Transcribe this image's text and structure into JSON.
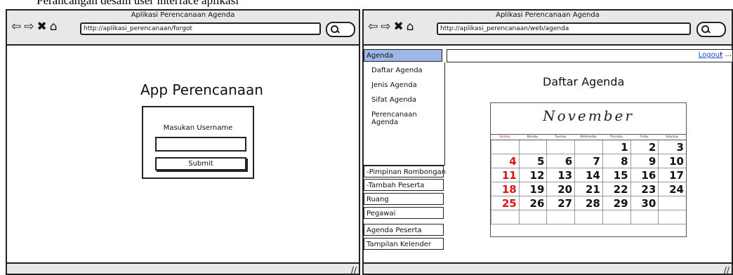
{
  "caption": "Perancangan desain user interface aplikasi",
  "window1": {
    "title": "Aplikasi Perencanaan Agenda",
    "url": "http://aplikasi_perencanaan/forgot",
    "app_title": "App Perencanaan",
    "username_label": "Masukan Username",
    "username_value": "",
    "submit_label": "Submit"
  },
  "window2": {
    "title": "Aplikasi Perencanaan Agenda",
    "url": "http://aplikasi_perencanaan/web/agenda",
    "logout_label": "Logout",
    "logout_extra": "› ...",
    "sidebar": {
      "active": "Agenda",
      "sub_items": [
        "Daftar Agenda",
        "Jenis Agenda",
        "Sifat Agenda",
        "Perencanaan Agenda"
      ],
      "items": [
        "-Pimpinan Rombongan",
        "-Tambah Peserta",
        "Ruang",
        "Pegawai",
        "Agenda Peserta",
        "Tampilan Kelender"
      ]
    },
    "page_heading": "Daftar Agenda",
    "calendar": {
      "month": "November",
      "weekdays": [
        "Sunday",
        "Monday",
        "Tuesday",
        "Wednesday",
        "Thursday",
        "Friday",
        "Saturday"
      ],
      "weeks": [
        [
          "",
          "",
          "",
          "",
          "1",
          "2",
          "3"
        ],
        [
          "4",
          "5",
          "6",
          "7",
          "8",
          "9",
          "10"
        ],
        [
          "11",
          "12",
          "13",
          "14",
          "15",
          "16",
          "17"
        ],
        [
          "18",
          "19",
          "20",
          "21",
          "22",
          "23",
          "24"
        ],
        [
          "25",
          "26",
          "27",
          "28",
          "29",
          "30",
          ""
        ],
        [
          "",
          "",
          "",
          "",
          "",
          "",
          ""
        ]
      ]
    }
  },
  "icons": [
    "back-arrow-icon",
    "forward-arrow-icon",
    "close-icon",
    "home-icon",
    "search-icon",
    "resize-grip-icon"
  ]
}
